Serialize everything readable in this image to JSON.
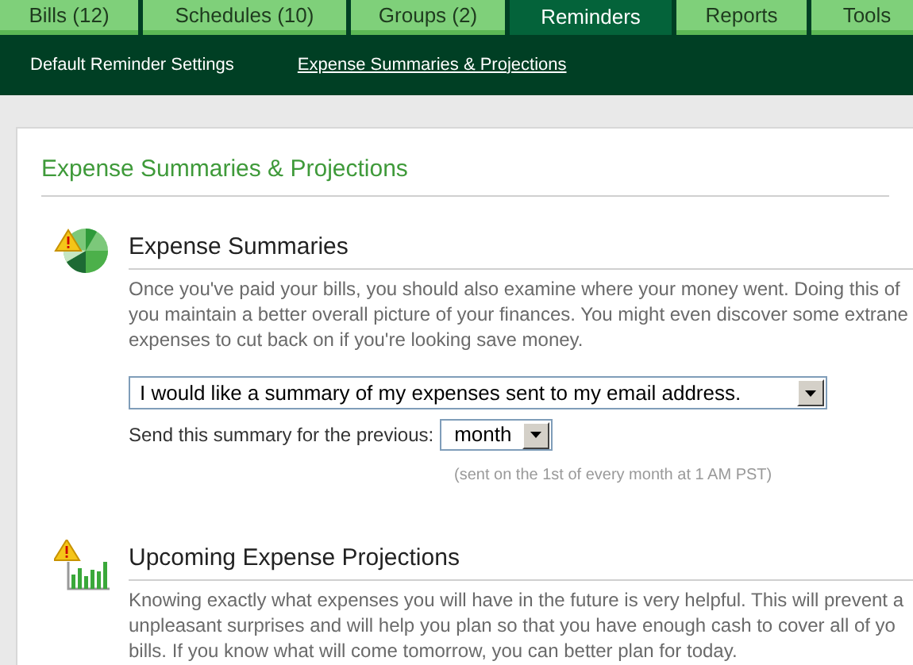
{
  "tabs": [
    {
      "label": "Bills (12)",
      "selected": false
    },
    {
      "label": "Schedules (10)",
      "selected": false
    },
    {
      "label": "Groups (2)",
      "selected": false
    },
    {
      "label": "Reminders",
      "selected": true
    },
    {
      "label": "Reports",
      "selected": false
    },
    {
      "label": "Tools",
      "selected": false
    }
  ],
  "subnav": [
    {
      "label": "Default Reminder Settings",
      "selected": false
    },
    {
      "label": "Expense Summaries & Projections",
      "selected": true
    }
  ],
  "page_title": "Expense Summaries & Projections",
  "sections": [
    {
      "kind": "summaries",
      "title": "Expense Summaries",
      "lines": [
        "Once you've paid your bills, you should also examine where your money went. Doing this of",
        "you maintain a better overall picture of your finances. You might even discover some extrane",
        "expenses to cut back on if you're looking save money."
      ],
      "select": {
        "value": "I would like a summary of my expenses sent to my email address."
      },
      "period_label": "Send this summary for the previous:",
      "period": {
        "value": "month"
      },
      "note": "(sent on the 1st of every month at 1 AM PST)"
    },
    {
      "kind": "projections",
      "title": "Upcoming Expense Projections",
      "lines": [
        "Knowing exactly what expenses you will have in the future is very helpful. This will prevent a",
        "unpleasant surprises and will help you plan so that you have enough cash to cover all of yo",
        "bills. If you know what will come tomorrow, you can better plan for today."
      ]
    }
  ]
}
